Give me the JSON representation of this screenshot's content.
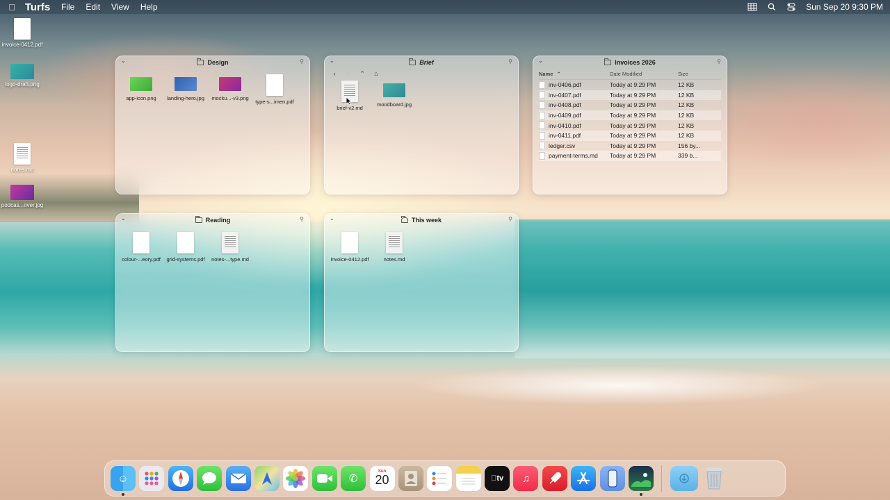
{
  "menubar": {
    "app_name": "Turfs",
    "menus": [
      "File",
      "Edit",
      "View",
      "Help"
    ],
    "clock": "Sun Sep 20  9:30 PM"
  },
  "desktop": {
    "items": [
      {
        "label": "invoice-0412.pdf",
        "kind": "doc"
      },
      {
        "label": "logo-draft.png",
        "kind": "image",
        "color": "#2ea8a8"
      },
      {
        "label": "notes.md",
        "kind": "doc-lines"
      },
      {
        "label": "podcas...over.jpg",
        "kind": "image",
        "color": "#9b2f9b"
      }
    ]
  },
  "widgets": {
    "design": {
      "title": "Design",
      "items": [
        {
          "label": "app-icon.png",
          "kind": "image",
          "color": "#5bc94a"
        },
        {
          "label": "landing-hero.jpg",
          "kind": "image",
          "color": "#3a6ab8"
        },
        {
          "label": "mocku...-v3.png",
          "kind": "image",
          "color": "#b8327a"
        },
        {
          "label": "type-s...imen.pdf",
          "kind": "doc"
        }
      ]
    },
    "brief": {
      "title": "Brief",
      "items": [
        {
          "label": "brief-v2.md",
          "kind": "doc-lines"
        },
        {
          "label": "moodboard.jpg",
          "kind": "image",
          "color": "#3aa39c"
        }
      ]
    },
    "invoices": {
      "title": "Invoices 2026",
      "columns": {
        "name": "Name",
        "date": "Date Modified",
        "size": "Size"
      },
      "rows": [
        {
          "name": "inv-0406.pdf",
          "date": "Today at 9:29 PM",
          "size": "12 KB"
        },
        {
          "name": "inv-0407.pdf",
          "date": "Today at 9:29 PM",
          "size": "12 KB"
        },
        {
          "name": "inv-0408.pdf",
          "date": "Today at 9:29 PM",
          "size": "12 KB"
        },
        {
          "name": "inv-0409.pdf",
          "date": "Today at 9:29 PM",
          "size": "12 KB"
        },
        {
          "name": "inv-0410.pdf",
          "date": "Today at 9:29 PM",
          "size": "12 KB"
        },
        {
          "name": "inv-0411.pdf",
          "date": "Today at 9:29 PM",
          "size": "12 KB"
        },
        {
          "name": "ledger.csv",
          "date": "Today at 9:29 PM",
          "size": "156 by..."
        },
        {
          "name": "payment-terms.md",
          "date": "Today at 9:29 PM",
          "size": "339 b..."
        }
      ]
    },
    "reading": {
      "title": "Reading",
      "items": [
        {
          "label": "colour-...eory.pdf",
          "kind": "doc"
        },
        {
          "label": "grid-systems.pdf",
          "kind": "doc"
        },
        {
          "label": "notes-...type.md",
          "kind": "doc-lines"
        }
      ]
    },
    "thisweek": {
      "title": "This week",
      "items": [
        {
          "label": "invoice-0412.pdf",
          "kind": "doc"
        },
        {
          "label": "notes.md",
          "kind": "doc-lines"
        }
      ]
    }
  },
  "dock": {
    "calendar_day": "20",
    "calendar_month": "Sun",
    "apps": [
      "finder-icon",
      "launchpad-icon",
      "safari-icon",
      "messages-icon",
      "mail-icon",
      "maps-icon",
      "photos-icon",
      "facetime-icon",
      "phone-icon",
      "calendar-icon",
      "contacts-icon",
      "reminders-icon",
      "notes-icon",
      "appletv-icon",
      "music-icon",
      "rocket-icon",
      "appstore-icon",
      "iphone-mirroring-icon",
      "turfs-icon"
    ],
    "tv_label": "tv"
  }
}
